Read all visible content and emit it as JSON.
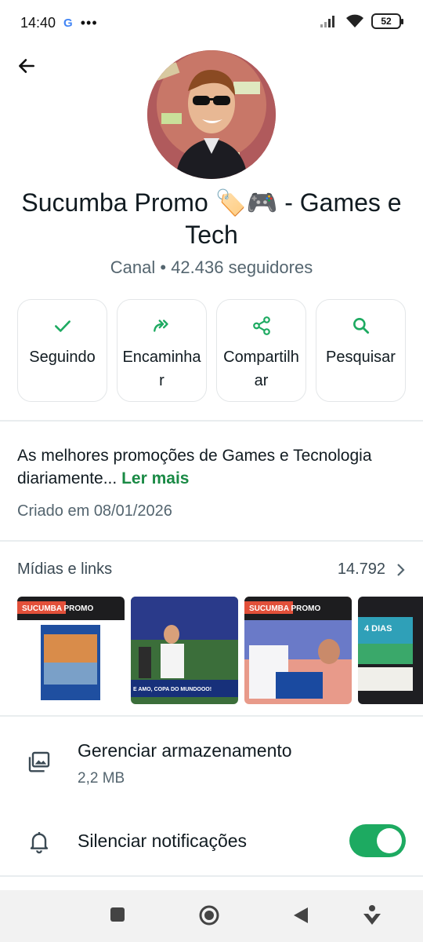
{
  "status_bar": {
    "time": "14:40",
    "google": "G",
    "dots": "•••",
    "battery": "52"
  },
  "channel": {
    "name": "Sucumba Promo 🏷️🎮  - Games e Tech",
    "subtitle": "Canal • 42.436 seguidores"
  },
  "actions": [
    {
      "label": "Seguindo",
      "icon": "check-icon"
    },
    {
      "label": "Encaminhar",
      "icon": "forward-icon"
    },
    {
      "label": "Compartilhar",
      "icon": "share-icon"
    },
    {
      "label": "Pesquisar",
      "icon": "search-icon"
    }
  ],
  "description": {
    "text": "As melhores promoções de Games e Tecnologia diariamente... ",
    "more": "Ler mais",
    "created": "Criado em 08/01/2026"
  },
  "media": {
    "title": "Mídias e links",
    "count": "14.792",
    "thumbs": [
      {
        "caption": "SUCUMBA PROMO"
      },
      {
        "caption": "E AMO, COPA DO MUNDOOO!"
      },
      {
        "caption": "SUCUMBA PROMO"
      },
      {
        "caption": "4 DIAS"
      }
    ]
  },
  "settings": {
    "storage_title": "Gerenciar armazenamento",
    "storage_size": "2,2 MB",
    "mute_title": "Silenciar notificações"
  },
  "colors": {
    "accent": "#1daa61",
    "link": "#1a8a45"
  }
}
